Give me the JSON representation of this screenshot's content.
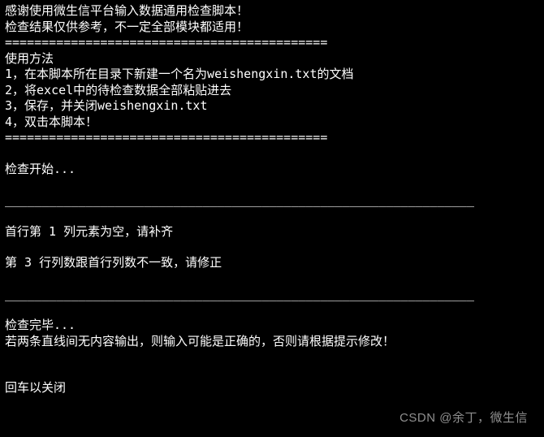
{
  "terminal": {
    "lines": [
      "感谢使用微生信平台输入数据通用检查脚本！",
      "检查结果仅供参考，不一定全部模块都适用！",
      "============================================",
      "使用方法",
      "1，在本脚本所在目录下新建一个名为weishengxin.txt的文档",
      "2，将excel中的待检查数据全部粘贴进去",
      "3，保存，并关闭weishengxin.txt",
      "4，双击本脚本！",
      "============================================",
      "",
      "检查开始...",
      "",
      "________________________________________________________________",
      "",
      "首行第 1 列元素为空，请补齐",
      "",
      "第 3 行列数跟首行列数不一致，请修正",
      "",
      "________________________________________________________________",
      "",
      "检查完毕...",
      "若两条直线间无内容输出，则输入可能是正确的，否则请根据提示修改！",
      "",
      "",
      "回车以关闭"
    ]
  },
  "watermark": "CSDN @余丁，微生信"
}
